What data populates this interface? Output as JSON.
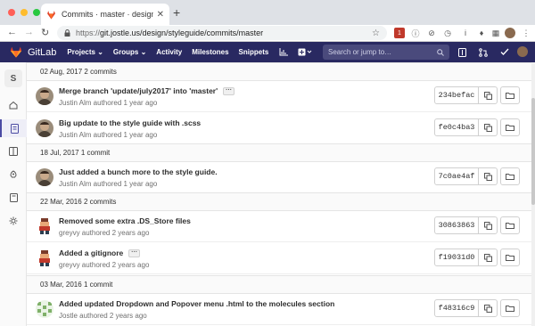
{
  "browser": {
    "tab_title": "Commits · master · design / St",
    "tab_close": "✕",
    "new_tab": "+",
    "url_scheme": "https://",
    "url_rest": "git.jostle.us/design/styleguide/commits/master",
    "ext_badge": "1"
  },
  "header": {
    "app_name": "GitLab",
    "nav": [
      {
        "label": "Projects ⌄"
      },
      {
        "label": "Groups ⌄"
      },
      {
        "label": "Activity"
      },
      {
        "label": "Milestones"
      },
      {
        "label": "Snippets"
      }
    ],
    "search_placeholder": "Search or jump to…"
  },
  "sidebar": {
    "avatar_letter": "S"
  },
  "commits": {
    "days": [
      {
        "date": "02 Aug, 2017",
        "count": "2 commits"
      },
      {
        "date": "18 Jul, 2017",
        "count": "1 commit"
      },
      {
        "date": "22 Mar, 2016",
        "count": "2 commits"
      },
      {
        "date": "03 Mar, 2016",
        "count": "1 commit"
      }
    ],
    "items": [
      {
        "title": "Merge branch 'update/july2017' into 'master'",
        "meta": "Justin Alm authored 1 year ago",
        "sha": "234befac",
        "ellipsis": "···"
      },
      {
        "title": "Big update to the style guide with .scss",
        "meta": "Justin Alm authored 1 year ago",
        "sha": "fe0c4ba3"
      },
      {
        "title": "Just added a bunch more to the style guide.",
        "meta": "Justin Alm authored 1 year ago",
        "sha": "7c0ae4af"
      },
      {
        "title": "Removed some extra .DS_Store files",
        "meta": "greyvy authored 2 years ago",
        "sha": "30863863"
      },
      {
        "title": "Added a gitignore",
        "meta": "greyvy authored 2 years ago",
        "sha": "f19031d0",
        "ellipsis": "···"
      },
      {
        "title": "Added updated Dropdown and Popover menu .html to the molecules section",
        "meta": "Jostle authored 2 years ago",
        "sha": "f48316c9"
      }
    ]
  },
  "colors": {
    "header_bg": "#292961",
    "gitlab_orange": "#e24329",
    "traffic_red": "#ff5f57",
    "traffic_yellow": "#febc2e",
    "traffic_green": "#28c840"
  }
}
